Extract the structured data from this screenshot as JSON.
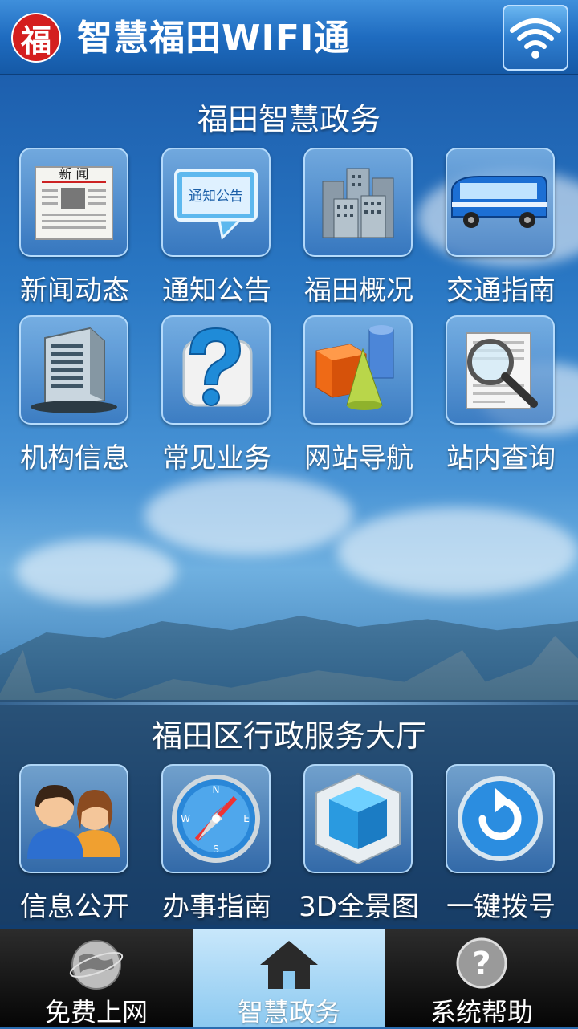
{
  "header": {
    "logo_char": "福",
    "title": "智慧福田WIFI通",
    "wifi_button": "wifi-icon"
  },
  "section1": {
    "title": "福田智慧政务",
    "items": [
      {
        "label": "新闻动态",
        "icon": "newspaper-icon",
        "badge_text": "新闻"
      },
      {
        "label": "通知公告",
        "icon": "notice-bubble-icon",
        "badge_text": "通知公告"
      },
      {
        "label": "福田概况",
        "icon": "buildings-icon"
      },
      {
        "label": "交通指南",
        "icon": "bus-icon"
      },
      {
        "label": "机构信息",
        "icon": "office-building-icon"
      },
      {
        "label": "常见业务",
        "icon": "question-icon"
      },
      {
        "label": "网站导航",
        "icon": "shapes-icon"
      },
      {
        "label": "站内查询",
        "icon": "magnifier-icon"
      }
    ]
  },
  "section2": {
    "title": "福田区行政服务大厅",
    "items": [
      {
        "label": "信息公开",
        "icon": "people-icon"
      },
      {
        "label": "办事指南",
        "icon": "compass-icon"
      },
      {
        "label": "3D全景图",
        "icon": "cube-icon"
      },
      {
        "label": "一键拨号",
        "icon": "redial-icon"
      }
    ]
  },
  "bottom_nav": {
    "items": [
      {
        "label": "免费上网",
        "icon": "globe-icon",
        "active": false
      },
      {
        "label": "智慧政务",
        "icon": "home-icon",
        "active": true
      },
      {
        "label": "系统帮助",
        "icon": "help-icon",
        "active": false
      }
    ]
  },
  "colors": {
    "header": "#1f6cc0",
    "logo": "#d41f1f",
    "active_tab": "#8cc9f0"
  }
}
